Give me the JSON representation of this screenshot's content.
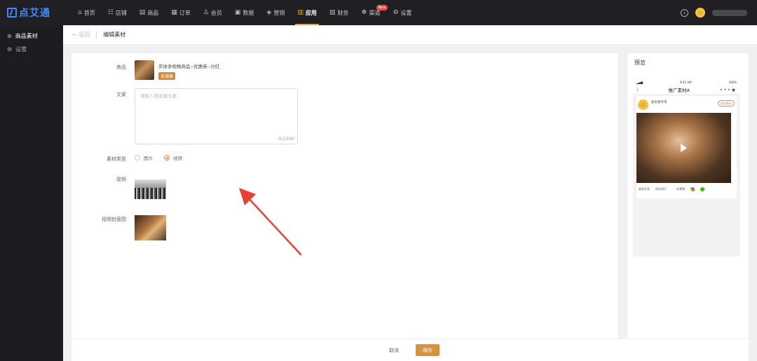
{
  "app": {
    "logo_text": "点艾通"
  },
  "nav": {
    "items": [
      {
        "label": "首页",
        "icon": "home-icon",
        "glyph": "⌂"
      },
      {
        "label": "店铺",
        "icon": "store-icon",
        "glyph": "☷"
      },
      {
        "label": "商品",
        "icon": "goods-icon",
        "glyph": "▤"
      },
      {
        "label": "订单",
        "icon": "order-icon",
        "glyph": "▦"
      },
      {
        "label": "会员",
        "icon": "member-icon",
        "glyph": "♙"
      },
      {
        "label": "数据",
        "icon": "data-icon",
        "glyph": "▣"
      },
      {
        "label": "营销",
        "icon": "tag-icon",
        "glyph": "◈"
      },
      {
        "label": "应用",
        "icon": "app-icon",
        "glyph": "▥"
      },
      {
        "label": "财务",
        "icon": "finance-icon",
        "glyph": "▧"
      },
      {
        "label": "渠道",
        "icon": "channel-icon",
        "glyph": "☸"
      },
      {
        "label": "设置",
        "icon": "settings-icon",
        "glyph": "⚙"
      }
    ],
    "active_index": 7,
    "new_badge": "New"
  },
  "sidebar": {
    "items": [
      {
        "label": "商品素材",
        "glyph": "⊕",
        "active": true
      },
      {
        "label": "设置",
        "glyph": "⚙",
        "active": false
      }
    ]
  },
  "breadcrumb": {
    "back": "← 返回",
    "title": "编辑素材"
  },
  "form": {
    "product_label": "商品",
    "product_name": "实体多规格商品--优惠券--分红",
    "product_tag": "多规格",
    "copy_label": "文案",
    "copy_placeholder": "请输入朋友圈文案",
    "copy_counter": "0/1500",
    "type_label": "素材类型",
    "type_options": [
      "图片",
      "视频"
    ],
    "type_selected": 1,
    "video_label": "视频",
    "cover_label": "视频封面图"
  },
  "footer": {
    "cancel": "取消",
    "save": "保存"
  },
  "preview": {
    "title": "预览",
    "status_time": "9:41 AM",
    "status_battery": "100%",
    "page_title": "推广素材A",
    "account_name": "朋友圈专用",
    "follow_btn": "发布素材",
    "actions": [
      "复制文案",
      "保存图片"
    ],
    "share_label": "分享到"
  },
  "colors": {
    "accent": "#e8a23c",
    "primary_btn": "#d8923c",
    "logo": "#3d8bff",
    "arrow": "#e84032"
  }
}
